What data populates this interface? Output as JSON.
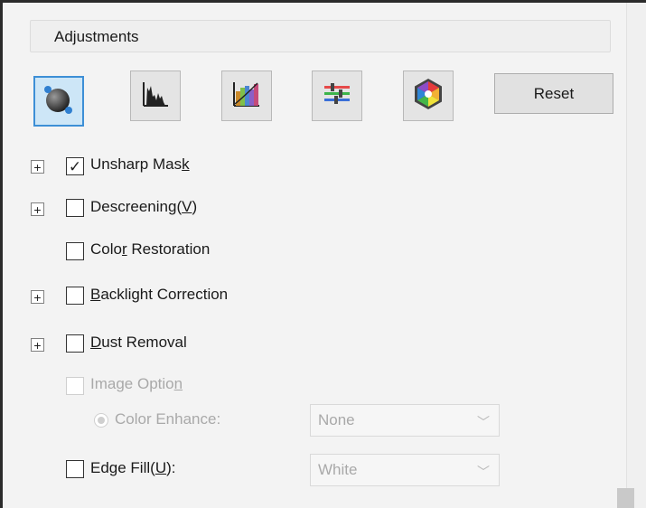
{
  "panel": {
    "title": "Adjustments",
    "reset_label": "Reset"
  },
  "toolbar": [
    {
      "icon": "auto-exposure-icon"
    },
    {
      "icon": "histogram-icon"
    },
    {
      "icon": "tone-curve-icon"
    },
    {
      "icon": "color-balance-icon"
    },
    {
      "icon": "color-palette-icon"
    }
  ],
  "options": {
    "unsharp_mask": {
      "label_pre": "Unsharp Mas",
      "label_ul": "k",
      "label_post": "",
      "checked": true,
      "expander": "+"
    },
    "descreening": {
      "label_pre": "Descreening(",
      "label_ul": "V",
      "label_post": ")",
      "checked": false,
      "expander": "+"
    },
    "color_restoration": {
      "label_pre": "Colo",
      "label_ul": "r",
      "label_post": " Restoration",
      "checked": false
    },
    "backlight_correction": {
      "label_pre": "",
      "label_ul": "B",
      "label_post": "acklight Correction",
      "checked": false,
      "expander": "+"
    },
    "dust_removal": {
      "label_pre": "",
      "label_ul": "D",
      "label_post": "ust Removal",
      "checked": false,
      "expander": "+"
    },
    "image_option": {
      "label_pre": "Image Optio",
      "label_ul": "n",
      "label_post": "",
      "checked": false,
      "disabled": true
    },
    "color_enhance": {
      "label": "Color Enhance:",
      "selected": true,
      "value": "None"
    },
    "edge_fill": {
      "label_pre": "Edge Fill(",
      "label_ul": "U",
      "label_post": "):",
      "checked": false,
      "value": "White"
    }
  },
  "colors": {
    "accent": "#3d8fd6",
    "disabled_text": "#a9a9a9"
  }
}
